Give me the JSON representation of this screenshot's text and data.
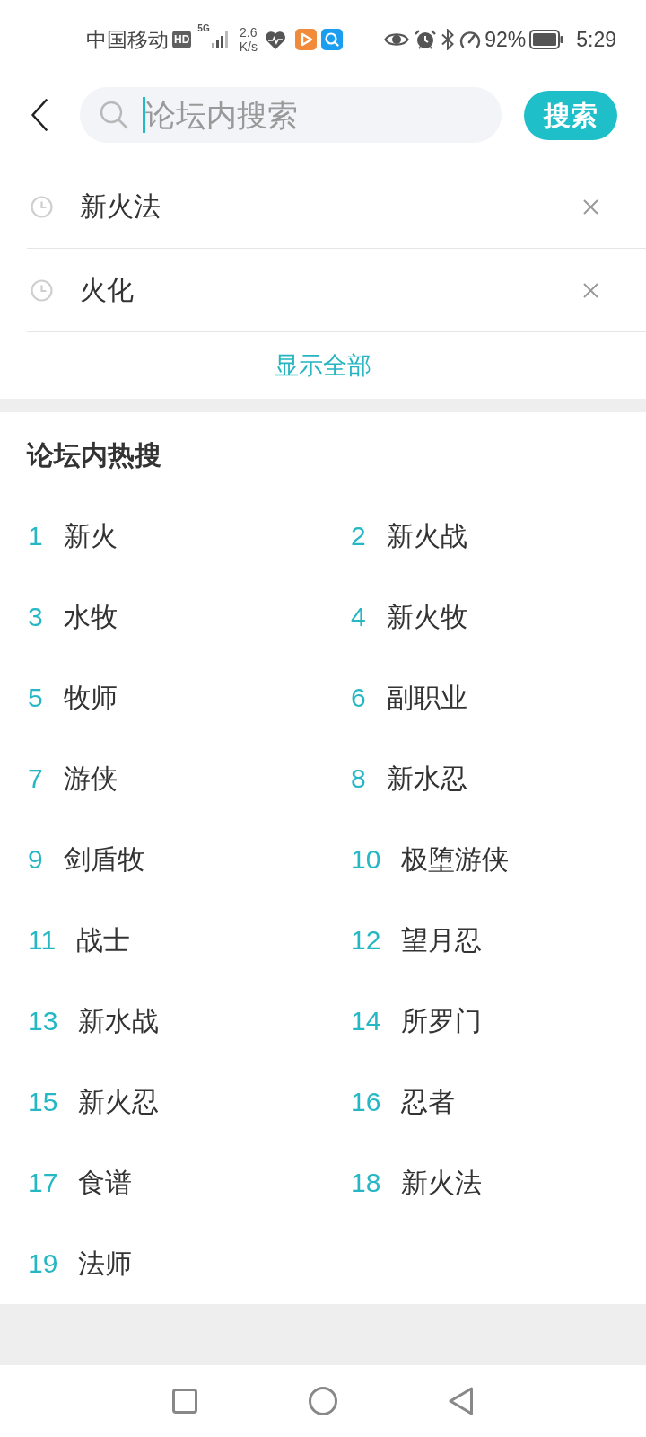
{
  "status_bar": {
    "carrier": "中国移动",
    "hd_badge": "HD",
    "network_type": "5G",
    "speed_value": "2.6",
    "speed_unit": "K/s",
    "battery": "92%",
    "time": "5:29"
  },
  "search": {
    "placeholder": "论坛内搜索",
    "focused": true,
    "button": "搜索"
  },
  "history": {
    "items": [
      {
        "text": "新火法"
      },
      {
        "text": "火化"
      }
    ],
    "show_all": "显示全部"
  },
  "hot_search": {
    "title": "论坛内热搜",
    "items": [
      {
        "rank": "1",
        "text": "新火"
      },
      {
        "rank": "2",
        "text": "新火战"
      },
      {
        "rank": "3",
        "text": "水牧"
      },
      {
        "rank": "4",
        "text": "新火牧"
      },
      {
        "rank": "5",
        "text": "牧师"
      },
      {
        "rank": "6",
        "text": "副职业"
      },
      {
        "rank": "7",
        "text": "游侠"
      },
      {
        "rank": "8",
        "text": "新水忍"
      },
      {
        "rank": "9",
        "text": "剑盾牧"
      },
      {
        "rank": "10",
        "text": "极堕游侠"
      },
      {
        "rank": "11",
        "text": "战士"
      },
      {
        "rank": "12",
        "text": "望月忍"
      },
      {
        "rank": "13",
        "text": "新水战"
      },
      {
        "rank": "14",
        "text": "所罗门"
      },
      {
        "rank": "15",
        "text": "新火忍"
      },
      {
        "rank": "16",
        "text": "忍者"
      },
      {
        "rank": "17",
        "text": "食谱"
      },
      {
        "rank": "18",
        "text": "新火法"
      },
      {
        "rank": "19",
        "text": "法师"
      }
    ]
  }
}
